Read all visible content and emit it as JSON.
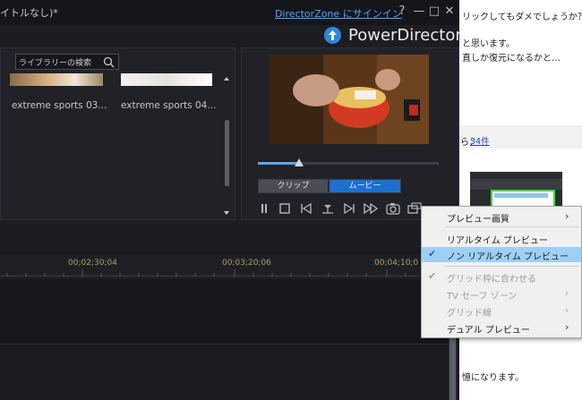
{
  "window": {
    "title": "イトルなし)*",
    "signin": "DirectorZone にサインイン",
    "help": "?",
    "minimize": "—",
    "maximize": "□",
    "close": "✕",
    "brand": "PowerDirector"
  },
  "library": {
    "search_placeholder": "ライブラリーの検索",
    "items": [
      {
        "label": "extreme sports 03..."
      },
      {
        "label": "extreme sports 04..."
      }
    ]
  },
  "preview": {
    "tabs": {
      "clip": "クリップ",
      "movie": "ムービー"
    },
    "selected_tab": "ムービー",
    "playback_position": 0.22,
    "controls": [
      "play-icon",
      "stop-icon",
      "previous-frame-icon",
      "split-icon",
      "next-frame-icon",
      "fast-forward-icon",
      "snapshot-icon",
      "display-icon",
      "zoom-icon",
      "preview-settings-icon"
    ]
  },
  "timeline": {
    "timecodes": [
      "00;02;30;04",
      "00;03;20;06",
      "00;04;10;0"
    ]
  },
  "webpage": {
    "lines": [
      "リックしてもダメでしょうか？",
      "と思います。",
      "直しか復元になるかと…",
      "ら：",
      "憶になります。"
    ],
    "link": "34件"
  },
  "context_menu": {
    "items": [
      {
        "label": "プレビュー画質",
        "submenu": true,
        "checked": false,
        "disabled": false
      },
      {
        "label": "リアルタイム プレビュー",
        "submenu": false,
        "checked": false,
        "disabled": false
      },
      {
        "label": "ノン リアルタイム プレビュー",
        "submenu": false,
        "checked": true,
        "disabled": false,
        "highlighted": true
      },
      {
        "label": "グリッド枠に合わせる",
        "submenu": false,
        "checked": true,
        "disabled": true
      },
      {
        "label": "TV セーフ ゾーン",
        "submenu": true,
        "checked": false,
        "disabled": true
      },
      {
        "label": "グリッド線",
        "submenu": true,
        "checked": false,
        "disabled": true
      },
      {
        "label": "デュアル プレビュー",
        "submenu": true,
        "checked": false,
        "disabled": false
      }
    ]
  },
  "colors": {
    "accent": "#1e6fd0",
    "menu_highlight": "#9fd0f4",
    "timecode": "#b2a067"
  }
}
